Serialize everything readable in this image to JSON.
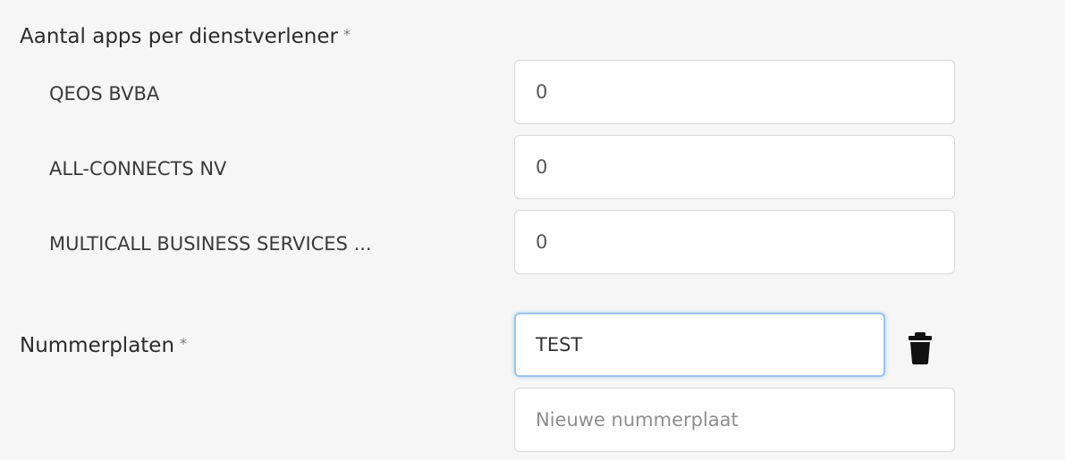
{
  "apps_section": {
    "label": "Aantal apps per dienstverlener",
    "required_mark": "*",
    "providers": [
      {
        "name": "QEOS BVBA",
        "value": "0"
      },
      {
        "name": "ALL-CONNECTS NV",
        "value": "0"
      },
      {
        "name": "MULTICALL BUSINESS SERVICES ...",
        "value": "0"
      }
    ]
  },
  "plates_section": {
    "label": "Nummerplaten",
    "required_mark": "*",
    "plates": [
      {
        "value": "TEST"
      }
    ],
    "new_plate": {
      "value": "",
      "placeholder": "Nieuwe nummerplaat"
    },
    "delete_icon": "trash-icon"
  },
  "colors": {
    "background": "#f6f6f6",
    "focus_border": "#9ec3ec",
    "input_border": "#d9d9d9"
  }
}
